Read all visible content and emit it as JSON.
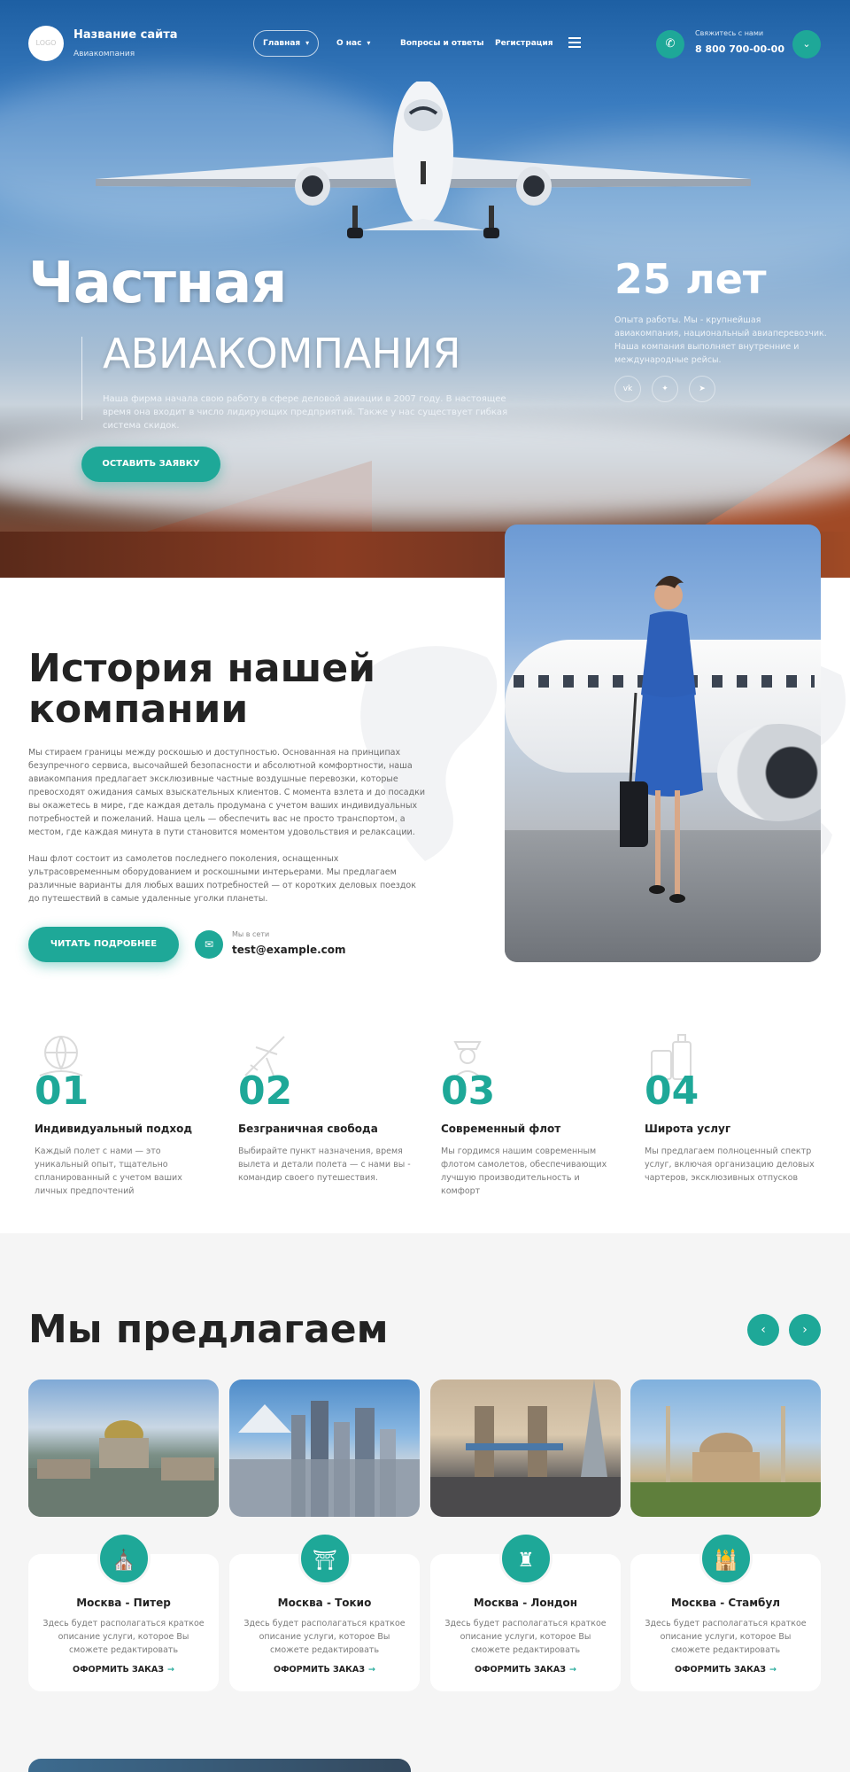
{
  "header": {
    "logo_text": "LOGO",
    "site_name": "Название сайта",
    "site_sub": "Авиакомпания",
    "nav": [
      {
        "label": "Главная",
        "caret": "▾"
      },
      {
        "label": "О нас",
        "caret": "▾"
      },
      {
        "label": "Вопросы и ответы"
      },
      {
        "label": "Регистрация"
      }
    ],
    "call_label": "Свяжитесь с нами",
    "phone": "8 800 700-00-00",
    "icons": {
      "phone": "phone-icon",
      "menu": "hamburger-icon",
      "down": "chevron-down-icon"
    }
  },
  "hero": {
    "title1": "Частная",
    "title2": "АВИАКОМПАНИЯ",
    "description": "Наша фирма начала свою работу в сфере деловой авиации в 2007 году. В настоящее время она входит в число лидирующих предприятий. Также у нас существует гибкая система скидок.",
    "cta": "ОСТАВИТЬ ЗАЯВКУ",
    "years": "25 лет",
    "years_desc": "Опыта работы. Мы - крупнейшая авиакомпания, национальный авиаперевозчик. Наша компания выполняет внутренние и международные рейсы.",
    "social": [
      {
        "icon": "vk-icon",
        "glyph": "vk"
      },
      {
        "icon": "twitter-icon",
        "glyph": "✦"
      },
      {
        "icon": "telegram-icon",
        "glyph": "➤"
      }
    ]
  },
  "history": {
    "title": "История нашей компании",
    "p1": "Мы стираем границы между роскошью и доступностью. Основанная на принципах безупречного сервиса, высочайшей безопасности и абсолютной комфортности, наша авиакомпания предлагает эксклюзивные частные воздушные перевозки, которые превосходят ожидания самых взыскательных клиентов. С момента взлета и до посадки вы окажетесь в мире, где каждая деталь продумана с учетом ваших индивидуальных потребностей и пожеланий. Наша цель — обеспечить вас не просто транспортом, а местом, где каждая минута в пути становится моментом удовольствия и релаксации.",
    "p2": "Наш флот состоит из самолетов последнего поколения, оснащенных ультрасовременным оборудованием и роскошными интерьерами. Мы предлагаем различные варианты для любых ваших потребностей — от коротких деловых поездок до путешествий в самые удаленные уголки планеты.",
    "read_more": "ЧИТАТЬ ПОДРОБНЕЕ",
    "mail_label": "Мы в сети",
    "mail": "test@example.com"
  },
  "features": [
    {
      "num": "01",
      "title": "Индивидуальный подход",
      "desc": "Каждый полет с нами — это уникальный опыт, тщательно спланированный с учетом ваших личных предпочтений",
      "icon": "globe-hand-icon"
    },
    {
      "num": "02",
      "title": "Безграничная свобода",
      "desc": "Выбирайте пункт назначения, время вылета и детали полета — с нами вы - командир своего путешествия.",
      "icon": "plane-icon"
    },
    {
      "num": "03",
      "title": "Современный флот",
      "desc": "Мы гордимся нашим современным флотом самолетов, обеспечивающих лучшую производительность и комфорт",
      "icon": "pilot-icon"
    },
    {
      "num": "04",
      "title": "Широта услуг",
      "desc": "Мы предлагаем полноценный спектр услуг, включая организацию деловых чартеров, эксклюзивных отпусков",
      "icon": "luggage-icon"
    }
  ],
  "offer": {
    "title": "Мы предлагаем",
    "prev": "‹",
    "next": "›",
    "cards": [
      {
        "title": "Москва - Питер",
        "desc": "Здесь будет располагаться краткое описание услуги, которое Вы сможете редактировать",
        "link": "ОФОРМИТЬ ЗАКАЗ",
        "arrow": "→",
        "badge": "⛪"
      },
      {
        "title": "Москва - Токио",
        "desc": "Здесь будет располагаться краткое описание услуги, которое Вы сможете редактировать",
        "link": "ОФОРМИТЬ ЗАКАЗ",
        "arrow": "→",
        "badge": "⛩"
      },
      {
        "title": "Москва - Лондон",
        "desc": "Здесь будет располагаться краткое описание услуги, которое Вы сможете редактировать",
        "link": "ОФОРМИТЬ ЗАКАЗ",
        "arrow": "→",
        "badge": "♜"
      },
      {
        "title": "Москва - Стамбул",
        "desc": "Здесь будет располагаться краткое описание услуги, которое Вы сможете редактировать",
        "link": "ОФОРМИТЬ ЗАКАЗ",
        "arrow": "→",
        "badge": "🕌"
      }
    ]
  },
  "colors": {
    "accent": "#1ea898",
    "dark": "#232323",
    "muted": "#7a7a7a"
  }
}
